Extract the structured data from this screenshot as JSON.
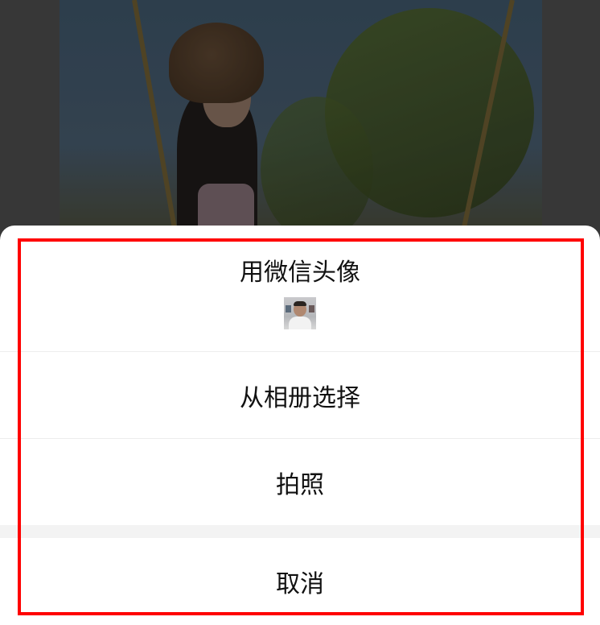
{
  "background": {
    "description_icon": "photo-icon"
  },
  "action_sheet": {
    "use_wechat_avatar_label": "用微信头像",
    "avatar_icon": "avatar-thumbnail",
    "choose_from_album_label": "从相册选择",
    "take_photo_label": "拍照",
    "cancel_label": "取消"
  },
  "colors": {
    "highlight_border": "#ff0000",
    "sheet_background": "#ffffff",
    "text": "#111111",
    "divider": "#ededed",
    "gap_band": "#f3f3f3"
  }
}
